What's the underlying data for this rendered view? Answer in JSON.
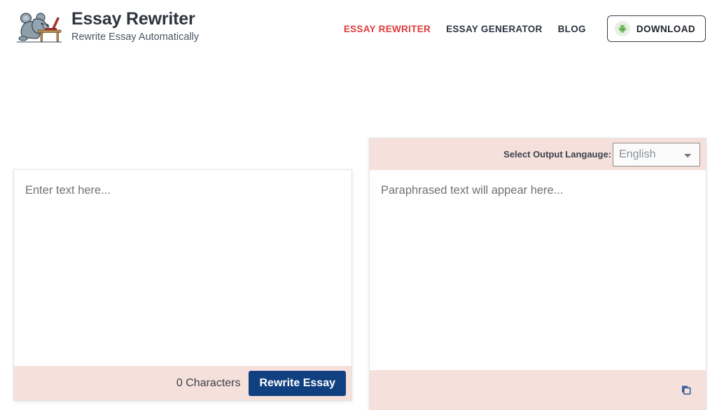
{
  "header": {
    "brand": {
      "logo_icon": "koala-at-desk-logo",
      "title": "Essay Rewriter",
      "tagline": "Rewrite Essay Automatically"
    },
    "nav": [
      {
        "label": "ESSAY REWRITER",
        "active": true
      },
      {
        "label": "ESSAY GENERATOR",
        "active": false
      },
      {
        "label": "BLOG",
        "active": false
      }
    ],
    "download_button": {
      "label": "DOWNLOAD",
      "icon": "android-icon"
    }
  },
  "input_panel": {
    "textarea_placeholder": "Enter text here...",
    "textarea_value": "",
    "char_count": "0 Characters",
    "rewrite_label": "Rewrite Essay"
  },
  "output_panel": {
    "language_label": "Select Output Langauge:",
    "language_selected": "English",
    "language_options": [
      "English"
    ],
    "textarea_placeholder": "Paraphrased text will appear here...",
    "textarea_value": "",
    "copy_icon": "copy-icon"
  },
  "colors": {
    "accent_red": "#e03b3b",
    "pink_bar": "#f5e0dc",
    "navy_button": "#104080",
    "android_green": "#63ad48",
    "text_dark": "#2e3440",
    "placeholder_gray": "#6e7277"
  }
}
